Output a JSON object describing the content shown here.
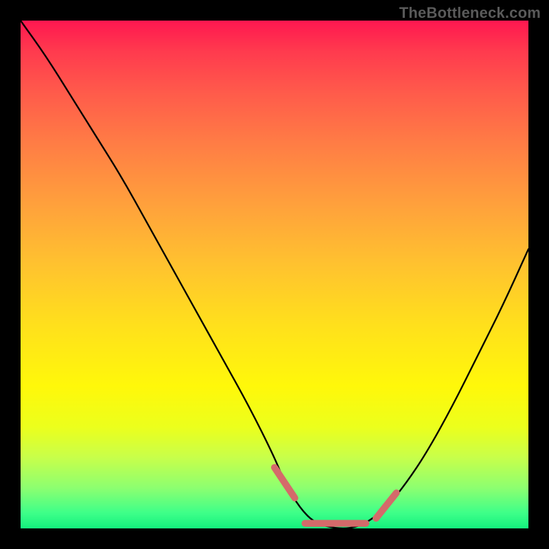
{
  "watermark": "TheBottleneck.com",
  "chart_data": {
    "type": "line",
    "title": "",
    "xlabel": "",
    "ylabel": "",
    "xlim": [
      0,
      100
    ],
    "ylim": [
      0,
      100
    ],
    "grid": false,
    "legend": false,
    "series": [
      {
        "name": "bottleneck-curve",
        "x": [
          0,
          5,
          10,
          15,
          20,
          25,
          30,
          35,
          40,
          45,
          50,
          52,
          55,
          58,
          62,
          65,
          68,
          72,
          76,
          80,
          85,
          90,
          95,
          100
        ],
        "y": [
          100,
          93,
          85,
          77,
          69,
          60,
          51,
          42,
          33,
          24,
          14,
          9,
          4,
          1,
          0,
          0,
          1,
          4,
          9,
          15,
          24,
          34,
          44,
          55
        ]
      }
    ],
    "annotations": [
      {
        "name": "valley-marker-left",
        "approx_x": 52,
        "approx_y": 9
      },
      {
        "name": "valley-marker-right",
        "approx_x": 72,
        "approx_y": 4
      }
    ],
    "background_gradient_stops": [
      {
        "pct": 0,
        "color": "#ff1750"
      },
      {
        "pct": 50,
        "color": "#ffd11a"
      },
      {
        "pct": 100,
        "color": "#14f07d"
      }
    ]
  }
}
